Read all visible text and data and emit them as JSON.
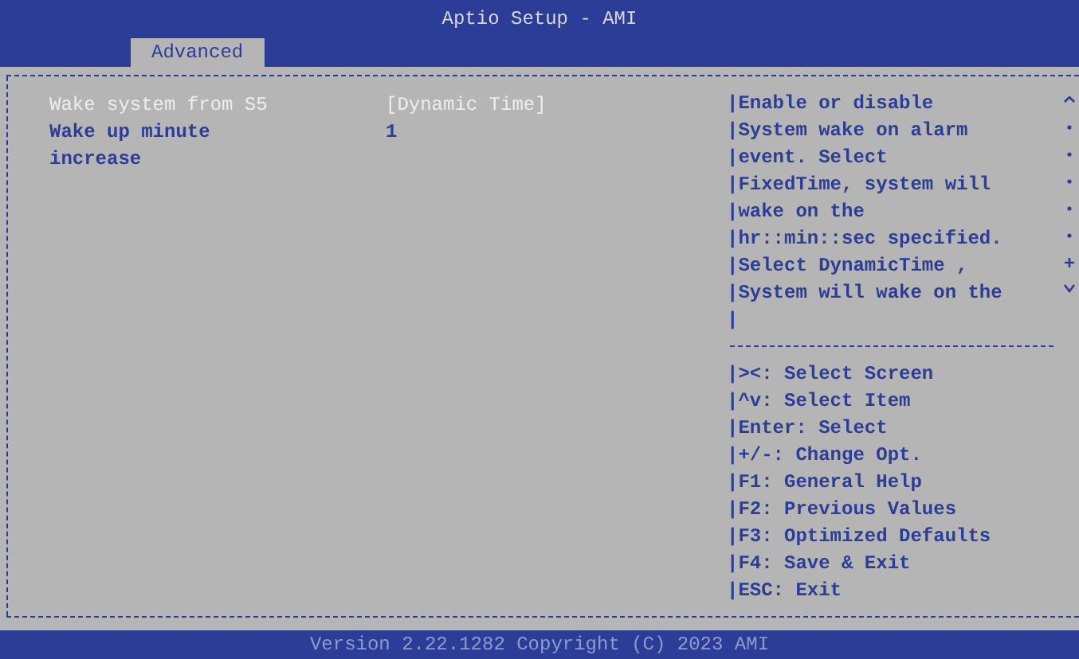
{
  "window": {
    "title": "Aptio Setup - AMI"
  },
  "tabs": [
    {
      "label": "Advanced",
      "selected": true
    }
  ],
  "settings": [
    {
      "label": "Wake system from S5",
      "value": "[Dynamic Time]",
      "selected": true
    },
    {
      "label": "Wake up minute",
      "value": "1",
      "selected": false
    },
    {
      "label": "increase",
      "selected": false
    }
  ],
  "help_text": [
    "|Enable or disable",
    "|System wake on alarm",
    "|event. Select",
    "|FixedTime, system will",
    "|wake on the",
    "|hr::min::sec specified.",
    "|Select DynamicTime ,",
    "|System will wake on the",
    "|"
  ],
  "key_help": [
    "|><: Select Screen",
    "|^v: Select Item",
    "|Enter: Select",
    "|+/-: Change Opt.",
    "|F1: General Help",
    "|F2: Previous Values",
    "|F3: Optimized Defaults",
    "|F4: Save & Exit",
    "|ESC: Exit"
  ],
  "status_bar": {
    "text": "Version 2.22.1282 Copyright (C) 2023 AMI"
  }
}
